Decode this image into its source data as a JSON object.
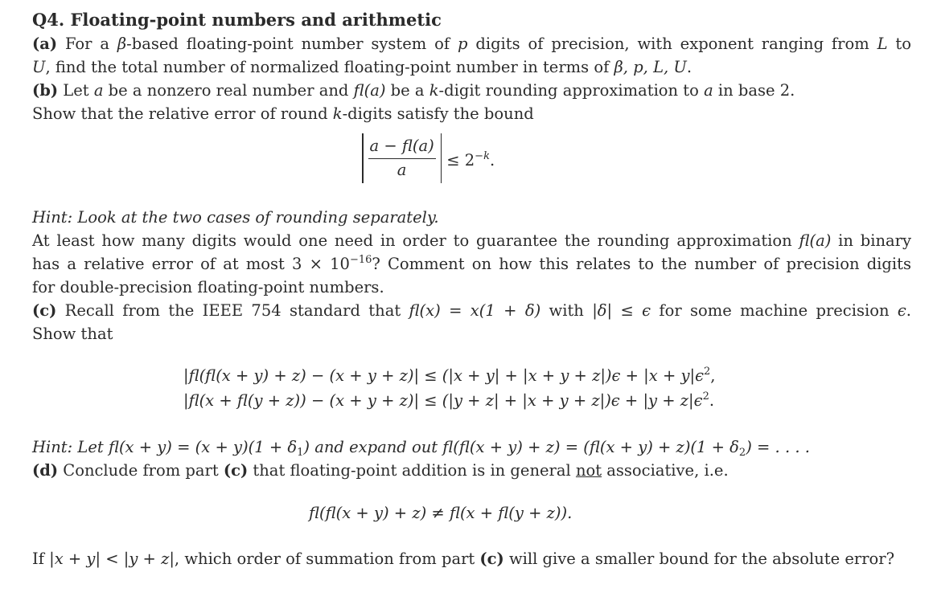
{
  "question": {
    "title": "Q4. Floating-point numbers and arithmetic",
    "part_a": {
      "label": "(a)",
      "line1_pre": " For a ",
      "beta": "β",
      "line1_mid": "-based floating-point number system of ",
      "p": "p",
      "line1_mid2": " digits of precision, with exponent ranging from ",
      "L": "L",
      "line1_post": " to",
      "line2_U": "U",
      "line2_text": ", find the total number of normalized floating-point number in terms of ",
      "line2_vars": "β, p, L, U",
      "line2_end": "."
    },
    "part_b": {
      "label": "(b)",
      "line1_pre": " Let ",
      "a": "a",
      "line1_mid": " be a nonzero real number and ",
      "fla": "fl(a)",
      "line1_mid2": " be a ",
      "k": "k",
      "line1_post": "-digit rounding approximation to ",
      "a2": "a",
      "line1_end": " in base 2.",
      "line2_pre": "Show that the relative error of round ",
      "k2": "k",
      "line2_post": "-digits satisfy the bound",
      "formula": {
        "numerator": "a − fl(a)",
        "denominator": "a",
        "relation": "≤ 2",
        "exponent": "−k",
        "end": "."
      },
      "hint": "Hint: Look at the two cases of rounding separately.",
      "q_line1_pre": "At least how many digits would one need in order to guarantee the rounding approximation ",
      "q_line1_fla": "fl(a)",
      "q_line1_post": " in binary",
      "q_line2_pre": "has a relative error of at most 3 × 10",
      "q_line2_exp": "−16",
      "q_line2_post": "? Comment on how this relates to the number of precision digits",
      "q_line3": "for double-precision floating-point numbers."
    },
    "part_c": {
      "label": "(c)",
      "line1_pre": " Recall from the IEEE 754 standard that ",
      "line1_math": "fl(x) = x(1 + δ)",
      "line1_mid": " with ",
      "line1_math2": "|δ| ≤ ϵ",
      "line1_post": " for some machine precision ",
      "eps": "ϵ",
      "line1_end": ".",
      "line2": "Show that",
      "eq1": "|fl(fl(x + y) + z) − (x + y + z)| ≤ (|x + y| + |x + y + z|)ϵ + |x + y|ϵ",
      "eq1_exp": "2",
      "eq1_end": ",",
      "eq2": "|fl(x + fl(y + z)) − (x + y + z)| ≤ (|y + z| + |x + y + z|)ϵ + |y + z|ϵ",
      "eq2_exp": "2",
      "eq2_end": ".",
      "hint_pre": "Hint: Let ",
      "hint_m1": "fl(x + y) = (x + y)(1 + δ",
      "hint_sub1": "1",
      "hint_m1_end": ")",
      "hint_mid": " and expand out ",
      "hint_m2": "fl(fl(x + y) + z) = (fl(x + y) + z)(1 + δ",
      "hint_sub2": "2",
      "hint_m2_end": ") = . . . ."
    },
    "part_d": {
      "label": "(d)",
      "line1_pre": " Conclude from part ",
      "ref": "(c)",
      "line1_mid": " that floating-point addition is in general ",
      "not": "not",
      "line1_post": " associative, i.e.",
      "formula": "fl(fl(x + y) + z) ≠ fl(x + fl(y + z)).",
      "last_pre": "If ",
      "last_math": "|x + y| < |y + z|",
      "last_mid": ", which order of summation from part ",
      "last_ref": "(c)",
      "last_post": " will give a smaller bound for the absolute error?"
    }
  }
}
